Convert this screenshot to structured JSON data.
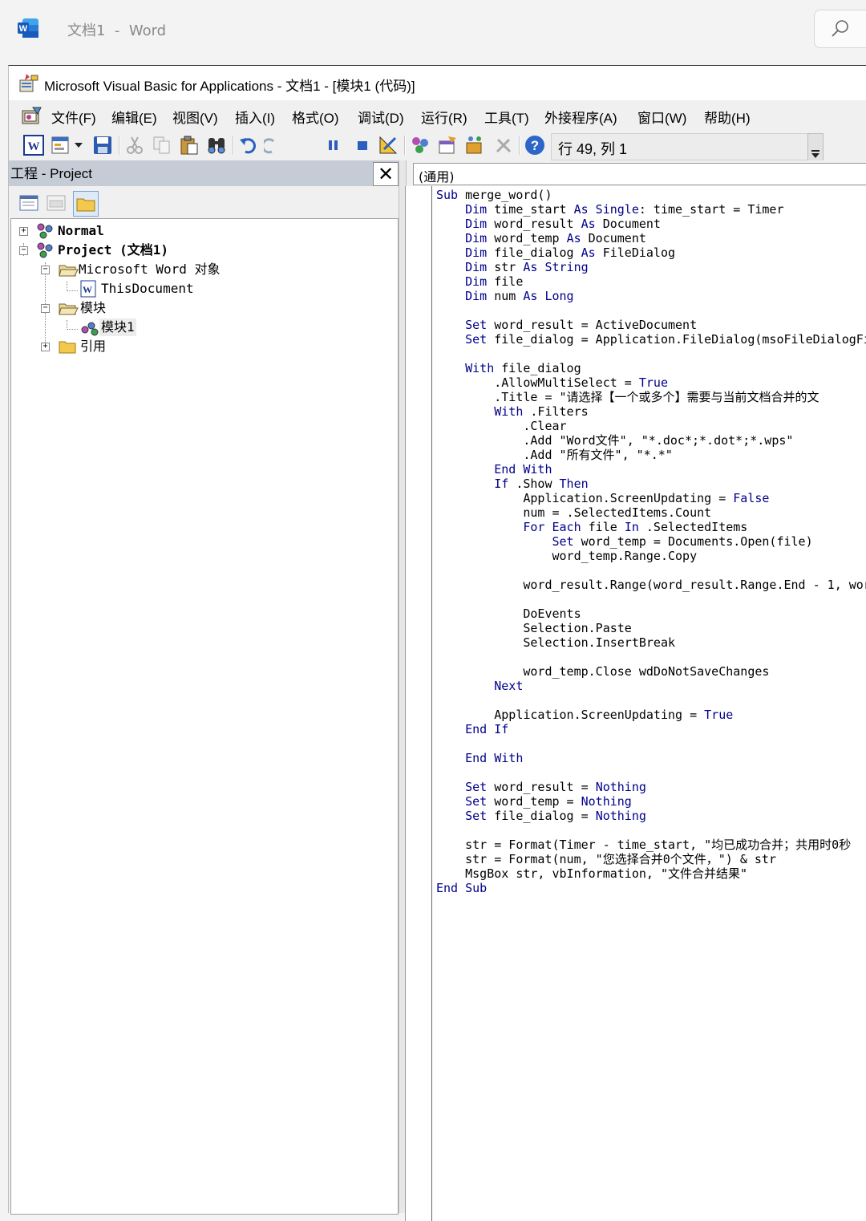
{
  "word": {
    "title": "文档1  -  Word",
    "logo_letter": "W"
  },
  "vba": {
    "title": "Microsoft Visual Basic for Applications - 文档1 - [模块1 (代码)]"
  },
  "menu": [
    "文件(F)",
    "编辑(E)",
    "视图(V)",
    "插入(I)",
    "格式(O)",
    "调试(D)",
    "运行(R)",
    "工具(T)",
    "外接程序(A)",
    "窗口(W)",
    "帮助(H)"
  ],
  "toolbar": {
    "position_text": "行 49, 列 1",
    "highlighted_button": "run-sub-button"
  },
  "project": {
    "title": "工程 - Project",
    "close_label": "✕",
    "tree": [
      {
        "label": "Normal",
        "bold": true
      },
      {
        "label": "Project (文档1)",
        "bold": true
      },
      {
        "label": "Microsoft Word 对象",
        "bold": false
      },
      {
        "label": "ThisDocument",
        "bold": false
      },
      {
        "label": "模块",
        "bold": false
      },
      {
        "label": "模块1",
        "bold": false
      },
      {
        "label": "引用",
        "bold": false
      }
    ]
  },
  "code": {
    "object_combo": "(通用)",
    "lines": [
      [
        [
          "k",
          "Sub "
        ],
        [
          "t",
          "merge_word()"
        ]
      ],
      [
        [
          "t",
          "    "
        ],
        [
          "k",
          "Dim "
        ],
        [
          "t",
          "time_start "
        ],
        [
          "k",
          "As Single"
        ],
        [
          "t",
          ": time_start = Timer"
        ]
      ],
      [
        [
          "t",
          "    "
        ],
        [
          "k",
          "Dim "
        ],
        [
          "t",
          "word_result "
        ],
        [
          "k",
          "As "
        ],
        [
          "t",
          "Document"
        ]
      ],
      [
        [
          "t",
          "    "
        ],
        [
          "k",
          "Dim "
        ],
        [
          "t",
          "word_temp "
        ],
        [
          "k",
          "As "
        ],
        [
          "t",
          "Document"
        ]
      ],
      [
        [
          "t",
          "    "
        ],
        [
          "k",
          "Dim "
        ],
        [
          "t",
          "file_dialog "
        ],
        [
          "k",
          "As "
        ],
        [
          "t",
          "FileDialog"
        ]
      ],
      [
        [
          "t",
          "    "
        ],
        [
          "k",
          "Dim "
        ],
        [
          "t",
          "str "
        ],
        [
          "k",
          "As String"
        ]
      ],
      [
        [
          "t",
          "    "
        ],
        [
          "k",
          "Dim "
        ],
        [
          "t",
          "file"
        ]
      ],
      [
        [
          "t",
          "    "
        ],
        [
          "k",
          "Dim "
        ],
        [
          "t",
          "num "
        ],
        [
          "k",
          "As Long"
        ]
      ],
      [],
      [
        [
          "t",
          "    "
        ],
        [
          "k",
          "Set "
        ],
        [
          "t",
          "word_result = ActiveDocument"
        ]
      ],
      [
        [
          "t",
          "    "
        ],
        [
          "k",
          "Set "
        ],
        [
          "t",
          "file_dialog = Application.FileDialog(msoFileDialogFi"
        ]
      ],
      [],
      [
        [
          "t",
          "    "
        ],
        [
          "k",
          "With "
        ],
        [
          "t",
          "file_dialog"
        ]
      ],
      [
        [
          "t",
          "        .AllowMultiSelect = "
        ],
        [
          "k",
          "True"
        ]
      ],
      [
        [
          "t",
          "        .Title = \"请选择【一个或多个】需要与当前文档合并的文"
        ]
      ],
      [
        [
          "t",
          "        "
        ],
        [
          "k",
          "With "
        ],
        [
          "t",
          ".Filters"
        ]
      ],
      [
        [
          "t",
          "            .Clear"
        ]
      ],
      [
        [
          "t",
          "            .Add \"Word文件\", \"*.doc*;*.dot*;*.wps\""
        ]
      ],
      [
        [
          "t",
          "            .Add \"所有文件\", \"*.*\""
        ]
      ],
      [
        [
          "t",
          "        "
        ],
        [
          "k",
          "End With"
        ]
      ],
      [
        [
          "t",
          "        "
        ],
        [
          "k",
          "If "
        ],
        [
          "t",
          ".Show "
        ],
        [
          "k",
          "Then"
        ]
      ],
      [
        [
          "t",
          "            Application.ScreenUpdating = "
        ],
        [
          "k",
          "False"
        ]
      ],
      [
        [
          "t",
          "            num = .SelectedItems.Count"
        ]
      ],
      [
        [
          "t",
          "            "
        ],
        [
          "k",
          "For Each "
        ],
        [
          "t",
          "file "
        ],
        [
          "k",
          "In "
        ],
        [
          "t",
          ".SelectedItems"
        ]
      ],
      [
        [
          "t",
          "                "
        ],
        [
          "k",
          "Set "
        ],
        [
          "t",
          "word_temp = Documents.Open(file)"
        ]
      ],
      [
        [
          "t",
          "                word_temp.Range.Copy"
        ]
      ],
      [],
      [
        [
          "t",
          "            word_result.Range(word_result.Range.End - 1, wor"
        ]
      ],
      [],
      [
        [
          "t",
          "            DoEvents"
        ]
      ],
      [
        [
          "t",
          "            Selection.Paste"
        ]
      ],
      [
        [
          "t",
          "            Selection.InsertBreak"
        ]
      ],
      [],
      [
        [
          "t",
          "            word_temp.Close wdDoNotSaveChanges"
        ]
      ],
      [
        [
          "t",
          "        "
        ],
        [
          "k",
          "Next"
        ]
      ],
      [],
      [
        [
          "t",
          "        Application.ScreenUpdating = "
        ],
        [
          "k",
          "True"
        ]
      ],
      [
        [
          "t",
          "    "
        ],
        [
          "k",
          "End If"
        ]
      ],
      [],
      [
        [
          "t",
          "    "
        ],
        [
          "k",
          "End With"
        ]
      ],
      [],
      [
        [
          "t",
          "    "
        ],
        [
          "k",
          "Set "
        ],
        [
          "t",
          "word_result = "
        ],
        [
          "k",
          "Nothing"
        ]
      ],
      [
        [
          "t",
          "    "
        ],
        [
          "k",
          "Set "
        ],
        [
          "t",
          "word_temp = "
        ],
        [
          "k",
          "Nothing"
        ]
      ],
      [
        [
          "t",
          "    "
        ],
        [
          "k",
          "Set "
        ],
        [
          "t",
          "file_dialog = "
        ],
        [
          "k",
          "Nothing"
        ]
      ],
      [],
      [
        [
          "t",
          "    str = Format(Timer - time_start, \"均已成功合并；共用时0秒"
        ]
      ],
      [
        [
          "t",
          "    str = Format(num, \"您选择合并0个文件，\") & str"
        ]
      ],
      [
        [
          "t",
          "    MsgBox str, vbInformation, \"文件合并结果\""
        ]
      ],
      [
        [
          "k",
          "End Sub"
        ]
      ]
    ]
  },
  "colors": {
    "keyword": "#00008b",
    "highlight": "#0a5bb8",
    "project_header": "#c5ccd6"
  }
}
